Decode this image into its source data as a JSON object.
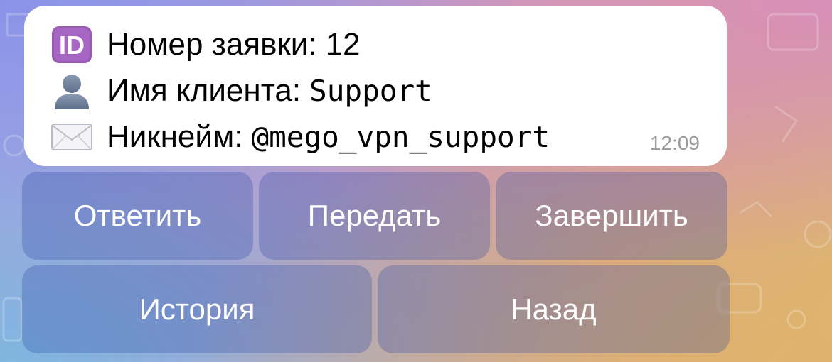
{
  "message": {
    "lines": [
      {
        "icon": "id-icon",
        "label": "Номер заявки:",
        "value": "12"
      },
      {
        "icon": "user-silhouette-icon",
        "label": "Имя клиента:",
        "value": "Support"
      },
      {
        "icon": "envelope-icon",
        "label": "Никнейм:",
        "value": "@mego_vpn_support"
      }
    ],
    "time": "12:09"
  },
  "keyboard": {
    "row1": [
      {
        "label": "Ответить"
      },
      {
        "label": "Передать"
      },
      {
        "label": "Завершить"
      }
    ],
    "row2": [
      {
        "label": "История"
      },
      {
        "label": "Назад"
      }
    ]
  },
  "colors": {
    "bubble": "#ffffff",
    "id_badge": "#9b59b6",
    "time_text": "#9a9a9f",
    "button_text": "#ffffff"
  }
}
